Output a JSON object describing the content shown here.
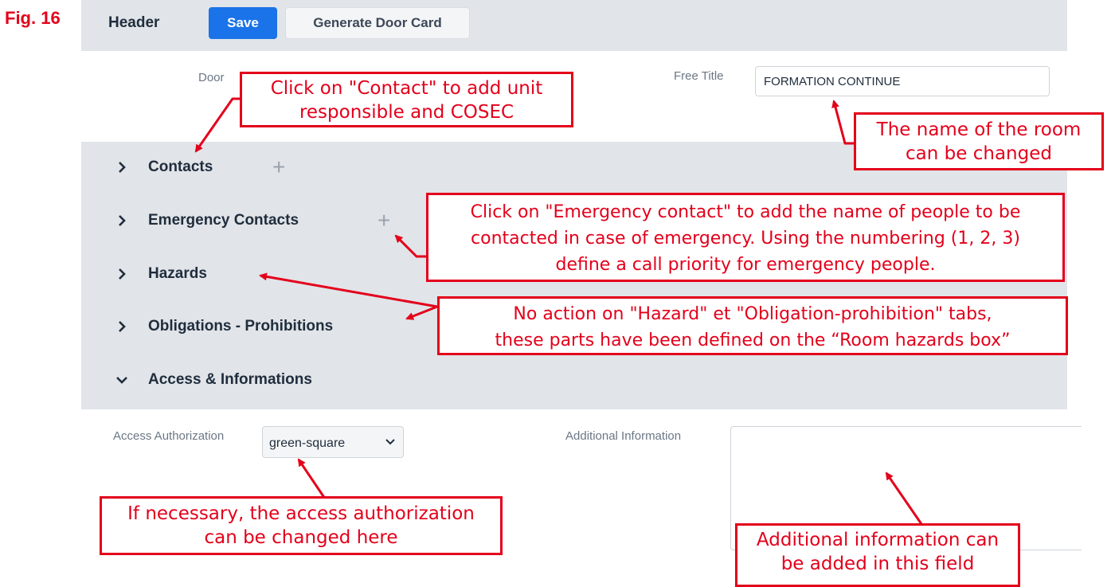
{
  "figure_label": "Fig. 16",
  "header": {
    "title": "Header",
    "save_label": "Save",
    "door_card_label": "Generate Door Card"
  },
  "form": {
    "door_label": "Door",
    "free_title_label": "Free Title",
    "free_title_value": "FORMATION CONTINUE"
  },
  "sections": [
    {
      "label": "Contacts",
      "expanded": false,
      "addable": true
    },
    {
      "label": "Emergency Contacts",
      "expanded": false,
      "addable": true
    },
    {
      "label": "Hazards",
      "expanded": false,
      "addable": false
    },
    {
      "label": "Obligations - Prohibitions",
      "expanded": false,
      "addable": false
    },
    {
      "label": "Access & Informations",
      "expanded": true,
      "addable": false
    }
  ],
  "access": {
    "authorization_label": "Access Authorization",
    "authorization_value": "green-square",
    "additional_info_label": "Additional Information",
    "additional_info_value": ""
  },
  "callouts": {
    "contact": [
      "Click on \"Contact\" to add unit",
      "responsible and COSEC"
    ],
    "room_name": [
      "The name of the room",
      "can be changed"
    ],
    "emergency": [
      "Click on \"Emergency contact\" to add the name of people to be",
      "contacted in case of emergency. Using the numbering (1, 2, 3)",
      "define a call priority for emergency people."
    ],
    "hazard": [
      "No action on \"Hazard\" et \"Obligation-prohibition\" tabs,",
      "these parts have been defined on the “Room hazards box”"
    ],
    "access": [
      "If necessary, the access authorization",
      "can be changed here"
    ],
    "additional": [
      "Additional information can",
      "be added in this field"
    ]
  },
  "colors": {
    "annotation_red": "#e3001b",
    "primary_blue": "#1a73e8",
    "panel_gray": "#e1e4e8"
  },
  "icons": {
    "section_collapsed": "chevron-right-icon",
    "section_expanded": "chevron-down-icon",
    "add": "plus-icon",
    "select": "chevron-down-icon"
  }
}
